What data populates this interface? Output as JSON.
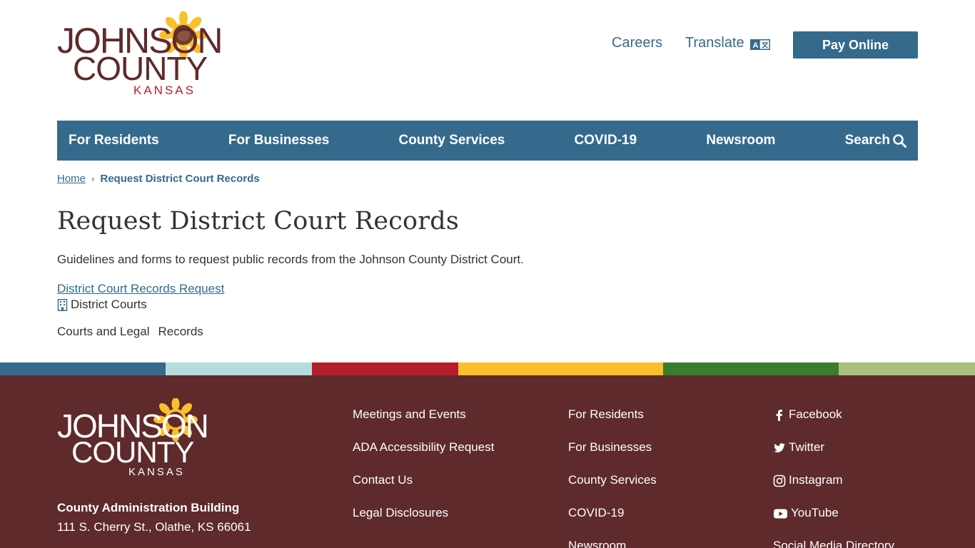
{
  "header": {
    "logo": {
      "line1": "JOHNSON",
      "line2": "COUNTY",
      "line3": "KANSAS"
    },
    "links": {
      "careers": "Careers",
      "translate": "Translate"
    },
    "translate_icon": "translate-icon",
    "pay_online": "Pay Online"
  },
  "nav": {
    "items": [
      "For Residents",
      "For Businesses",
      "County Services",
      "COVID-19",
      "Newsroom"
    ],
    "search": "Search",
    "search_icon": "search-icon"
  },
  "breadcrumb": {
    "home": "Home",
    "current": "Request District Court Records"
  },
  "main": {
    "title": "Request District Court Records",
    "intro": "Guidelines and forms to request public records from the Johnson County District Court.",
    "link": "District Court Records Request",
    "department": "District Courts",
    "department_icon": "building-icon",
    "tags": [
      "Courts and Legal",
      "Records"
    ]
  },
  "strip_colors": [
    "#356a8c",
    "#b5dde0",
    "#b41e2d",
    "#fbbf2c",
    "#3a7d2f",
    "#a8c07c"
  ],
  "footer": {
    "logo": {
      "line1": "JOHNSON",
      "line2": "COUNTY",
      "line3": "KANSAS"
    },
    "address": {
      "title": "County Administration Building",
      "line1": "111 S. Cherry St., Olathe, KS 66061"
    },
    "col1": [
      "Meetings and Events",
      "ADA Accessibility Request",
      "Contact Us",
      "Legal Disclosures"
    ],
    "col2": [
      "For Residents",
      "For Businesses",
      "County Services",
      "COVID-19",
      "Newsroom"
    ],
    "social": [
      {
        "label": "Facebook",
        "icon": "facebook-icon"
      },
      {
        "label": "Twitter",
        "icon": "twitter-icon"
      },
      {
        "label": "Instagram",
        "icon": "instagram-icon"
      },
      {
        "label": "YouTube",
        "icon": "youtube-icon"
      },
      {
        "label": "Social Media Directory",
        "icon": ""
      }
    ]
  },
  "colors": {
    "primary": "#356a8c",
    "footer_bg": "#5e2a2b",
    "logo_maroon": "#5e2a2b",
    "logo_red": "#b41e2d",
    "sunflower": "#fbbf2c"
  }
}
